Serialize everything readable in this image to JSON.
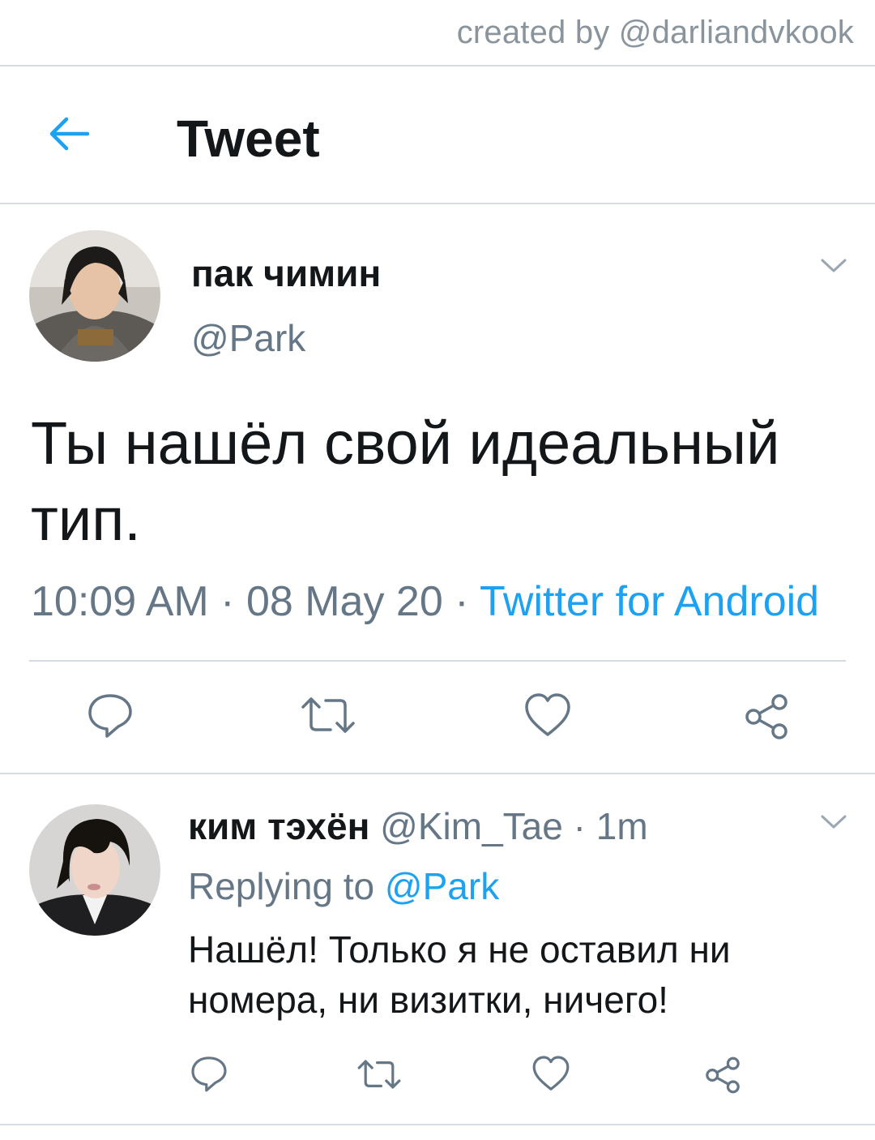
{
  "watermark": "created by @darliandvkook",
  "header": {
    "title": "Tweet"
  },
  "tweet": {
    "author_name": "пак чимин",
    "author_handle": "@Park",
    "text": "Ты нашёл свой идеальный тип.",
    "time": "10:09 AM",
    "date": "08 May 20",
    "source": "Twitter for Android"
  },
  "reply": {
    "author_name": "ким тэхён",
    "author_handle": "@Kim_Tae",
    "age": "1m",
    "replying_prefix": "Replying to",
    "replying_to": "@Park",
    "text": "Нашёл! Только я не оставил ни номера, ни визитки, ничего!"
  },
  "icons": [
    "back-arrow-icon",
    "chevron-down-icon",
    "reply-icon",
    "retweet-icon",
    "like-icon",
    "share-icon"
  ],
  "colors": {
    "accent": "#1da1f2",
    "secondary_text": "#657786",
    "divider": "#d5dbe0",
    "icon": "#657786"
  }
}
